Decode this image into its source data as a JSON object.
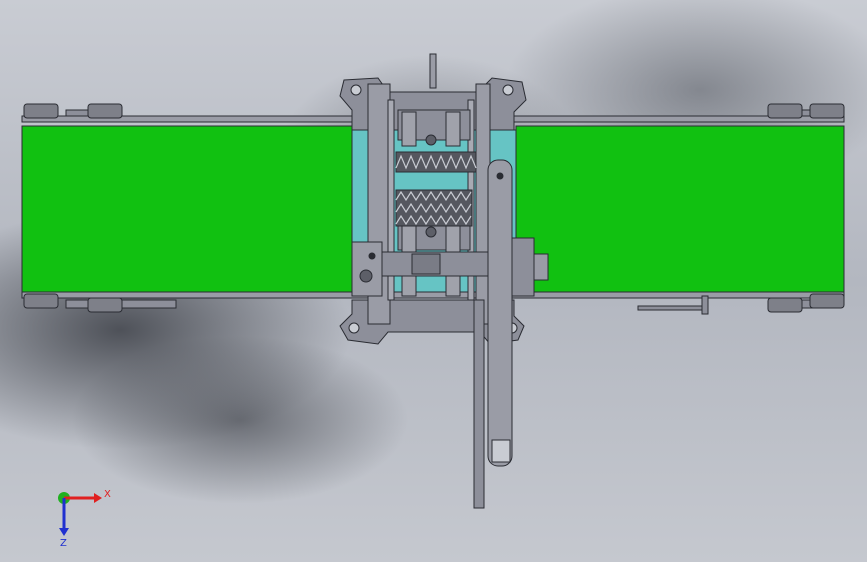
{
  "viewport": {
    "background_color": "#babdc5",
    "shading_color": "#4a4d55"
  },
  "model": {
    "belt_color": "#11c111",
    "plate_color": "#66c4c4",
    "frame_color": "#8d8f9a",
    "edge_color": "#2a2c33"
  },
  "triad": {
    "x_label": "X",
    "z_label": "Z",
    "x_color": "#e02020",
    "y_color": "#20b020",
    "z_color": "#2030d0"
  }
}
